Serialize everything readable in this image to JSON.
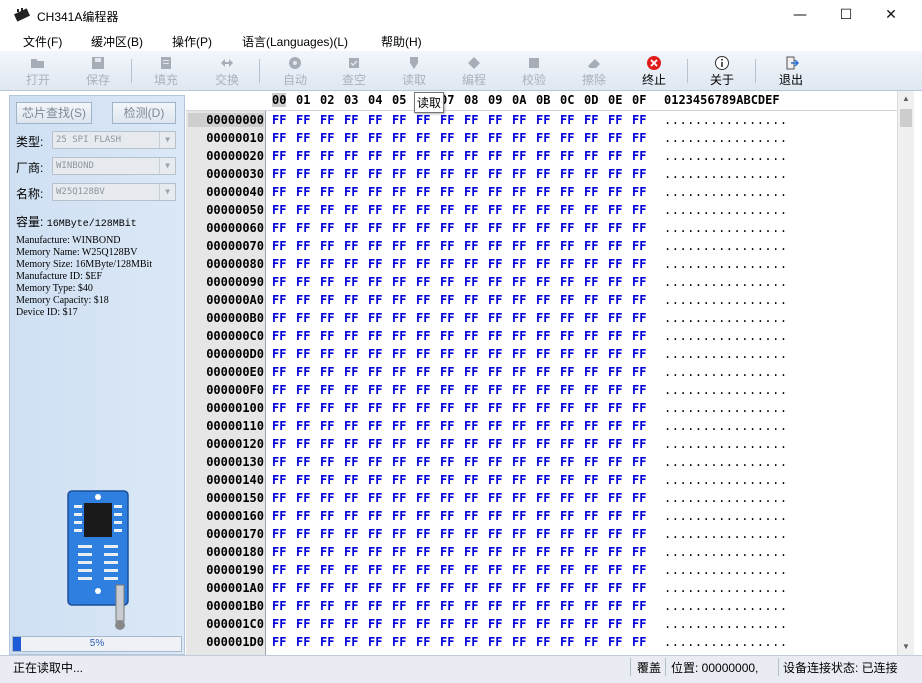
{
  "window": {
    "title": "CH341A编程器",
    "minimize": "—",
    "maximize": "☐",
    "close": "✕"
  },
  "menu": [
    "文件(F)",
    "缓冲区(B)",
    "操作(P)",
    "语言(Languages)(L)",
    "帮助(H)"
  ],
  "toolbar": {
    "buttons": [
      {
        "label": "打开",
        "icon": "folder-open-icon",
        "enabled": false
      },
      {
        "label": "保存",
        "icon": "save-icon",
        "enabled": false
      },
      {
        "label": "填充",
        "icon": "fill-icon",
        "enabled": false
      },
      {
        "label": "交换",
        "icon": "swap-icon",
        "enabled": false
      },
      {
        "label": "自动",
        "icon": "auto-icon",
        "enabled": false
      },
      {
        "label": "查空",
        "icon": "blank-check-icon",
        "enabled": false
      },
      {
        "label": "读取",
        "icon": "read-icon",
        "enabled": false
      },
      {
        "label": "编程",
        "icon": "program-icon",
        "enabled": false
      },
      {
        "label": "校验",
        "icon": "verify-icon",
        "enabled": false
      },
      {
        "label": "擦除",
        "icon": "erase-icon",
        "enabled": false
      },
      {
        "label": "终止",
        "icon": "stop-icon",
        "enabled": true
      },
      {
        "label": "关于",
        "icon": "info-icon",
        "enabled": true
      },
      {
        "label": "退出",
        "icon": "exit-icon",
        "enabled": true
      }
    ]
  },
  "left_panel": {
    "detect_chip_button": "芯片查找(S)",
    "detect_button": "检测(D)",
    "type_label": "类型:",
    "type_value": "25 SPI FLASH",
    "vendor_label": "厂商:",
    "vendor_value": "WINBOND",
    "name_label": "名称:",
    "name_value": "W25Q128BV",
    "capacity_label": "容量:",
    "capacity_value": "16MByte/128MBit",
    "info_lines": [
      "Manufacture: WINBOND",
      "Memory Name: W25Q128BV",
      "Memory Size: 16MByte/128MBit",
      "Manufacture ID: $EF",
      "Memory Type: $40",
      "Memory Capacity: $18",
      "Device ID: $17"
    ],
    "progress_percent": 5,
    "progress_text": "5%"
  },
  "hex": {
    "columns": [
      "00",
      "01",
      "02",
      "03",
      "04",
      "05",
      "06",
      "07",
      "08",
      "09",
      "0A",
      "0B",
      "0C",
      "0D",
      "0E",
      "0F"
    ],
    "ascii_header": "0123456789ABCDEF",
    "tooltip": "读取",
    "byte_value": "FF",
    "ascii_row": "................",
    "addresses": [
      "00000000",
      "00000010",
      "00000020",
      "00000030",
      "00000040",
      "00000050",
      "00000060",
      "00000070",
      "00000080",
      "00000090",
      "000000A0",
      "000000B0",
      "000000C0",
      "000000D0",
      "000000E0",
      "000000F0",
      "00000100",
      "00000110",
      "00000120",
      "00000130",
      "00000140",
      "00000150",
      "00000160",
      "00000170",
      "00000180",
      "00000190",
      "000001A0",
      "000001B0",
      "000001C0",
      "000001D0"
    ]
  },
  "status": {
    "message": "正在读取中...",
    "mode": "覆盖",
    "position": "位置: 00000000,",
    "connection": "设备连接状态: 已连接"
  },
  "colors": {
    "hex_bytes": "#0000d8",
    "progress": "#1e5bd6",
    "panel": "#d4e3f4"
  }
}
